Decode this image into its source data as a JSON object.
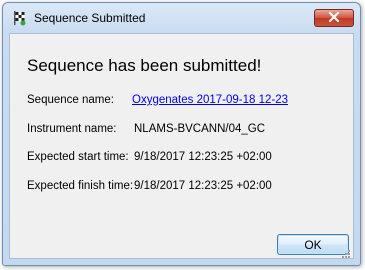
{
  "window": {
    "title": "Sequence Submitted"
  },
  "dialog": {
    "heading": "Sequence has been submitted!",
    "rows": [
      {
        "label": "Sequence name:",
        "value": "Oxygenates 2017-09-18 12-23"
      },
      {
        "label": "Instrument name:",
        "value": "NLAMS-BVCANN/04_GC"
      },
      {
        "label": "Expected start time:",
        "value": "9/18/2017 12:23:25 +02:00"
      },
      {
        "label": "Expected finish time:",
        "value": "9/18/2017 12:23:25 +02:00"
      }
    ],
    "ok_label": "OK"
  },
  "colors": {
    "link": "#0000ee",
    "close_button": "#c8553d",
    "ok_button_border": "#3c7fb1"
  },
  "icons": {
    "app": "checkered-flag-icon",
    "close": "close-icon",
    "grip": "resize-grip-icon"
  }
}
